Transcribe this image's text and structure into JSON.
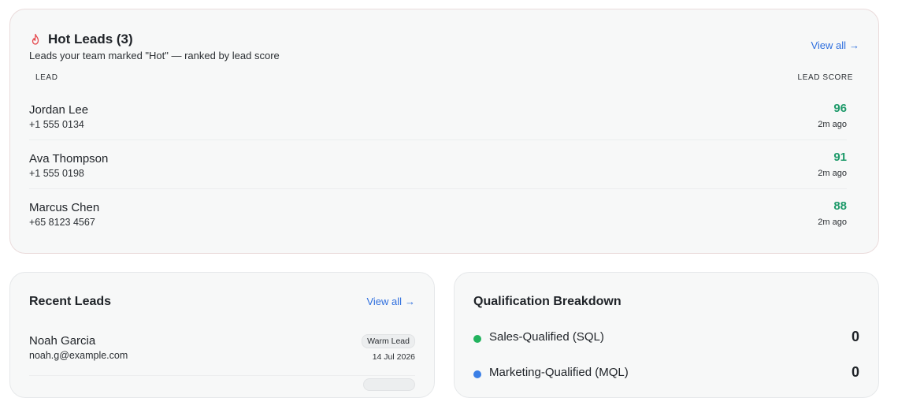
{
  "hot_leads": {
    "title": "Hot Leads (3)",
    "subtitle": "Leads your team marked \"Hot\" — ranked by lead score",
    "view_all": "View all",
    "view_all_arrow": "→",
    "col_lead": "LEAD",
    "col_score": "LEAD SCORE",
    "icon": "fire-icon",
    "rows": [
      {
        "name": "Jordan Lee",
        "phone": "+1 555 0134",
        "score": "96",
        "time": "2m ago"
      },
      {
        "name": "Ava Thompson",
        "phone": "+1 555 0198",
        "score": "91",
        "time": "2m ago"
      },
      {
        "name": "Marcus Chen",
        "phone": "+65 8123 4567",
        "score": "88",
        "time": "2m ago"
      }
    ]
  },
  "recent_leads": {
    "title": "Recent Leads",
    "view_all": "View all",
    "view_all_arrow": "→",
    "rows": [
      {
        "name": "Noah Garcia",
        "email": "noah.g@example.com",
        "badge": "Warm Lead",
        "date": "14 Jul 2026"
      }
    ]
  },
  "qualification": {
    "title": "Qualification Breakdown",
    "items": [
      {
        "label": "Sales-Qualified (SQL)",
        "count": "0",
        "color": "#22b35e"
      },
      {
        "label": "Marketing-Qualified (MQL)",
        "count": "0",
        "color": "#3b7fe6"
      }
    ]
  },
  "colors": {
    "accent_link": "#2f6fde",
    "score_green": "#1e9a6a",
    "fire_red": "#e5484d"
  }
}
